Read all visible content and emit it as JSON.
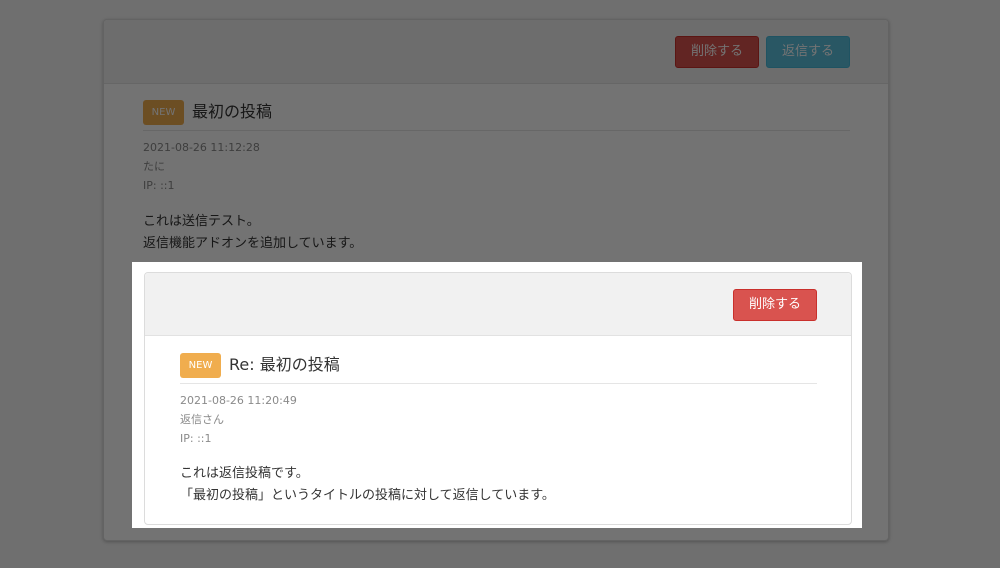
{
  "outer_post": {
    "header": {
      "delete_label": "削除する",
      "reply_label": "返信する"
    },
    "badge": "NEW",
    "title": "最初の投稿",
    "date": "2021-08-26 11:12:28",
    "author": "たに",
    "ip": "IP: ::1",
    "body_lines": [
      "これは送信テスト。",
      "返信機能アドオンを追加しています。"
    ]
  },
  "reply_post": {
    "header": {
      "delete_label": "削除する"
    },
    "badge": "NEW",
    "title": "Re: 最初の投稿",
    "date": "2021-08-26 11:20:49",
    "author": "返信さん",
    "ip": "IP: ::1",
    "body_lines": [
      "これは返信投稿です。",
      "「最初の投稿」というタイトルの投稿に対して返信しています。"
    ]
  },
  "colors": {
    "danger": "#d9534f",
    "info": "#5bc0de",
    "badge": "#f0ad4e",
    "header_bg": "#f1f1f1"
  }
}
